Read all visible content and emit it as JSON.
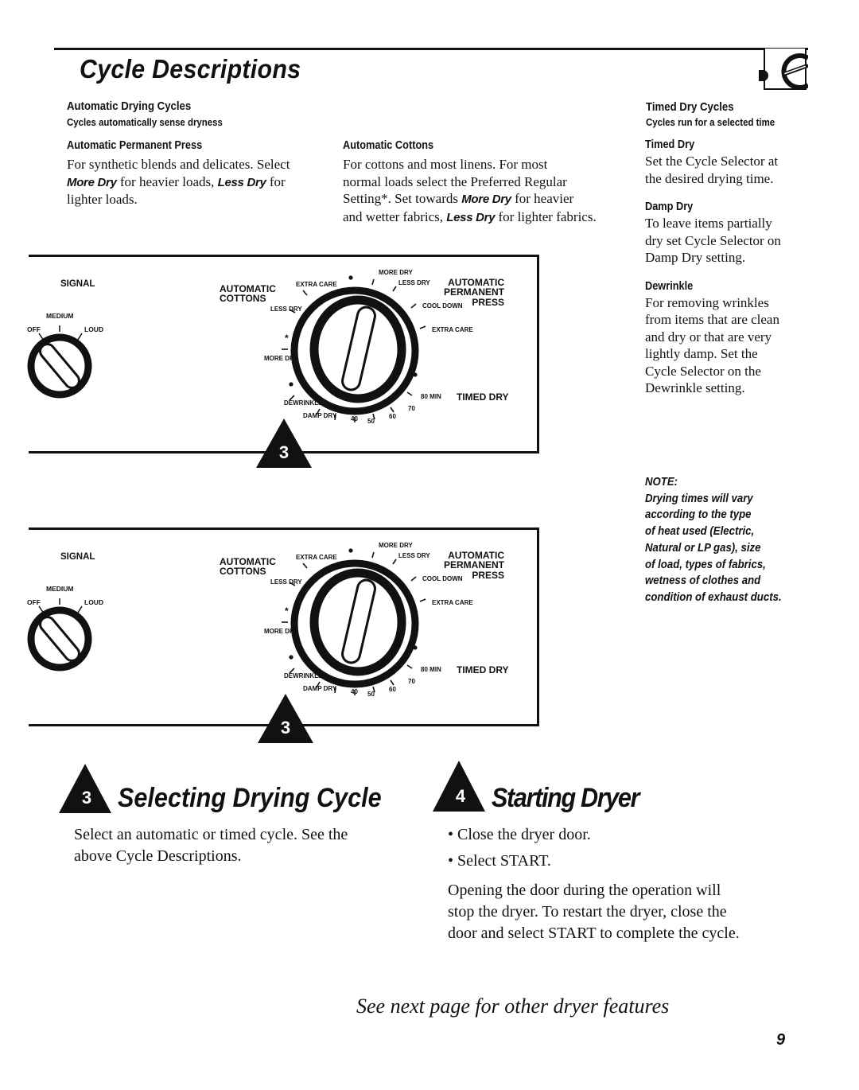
{
  "header": {
    "title": "Cycle Descriptions",
    "corner_icon": "dial-tab-icon"
  },
  "automatic": {
    "heading": "Automatic Drying Cycles",
    "subheading": "Cycles automatically sense dryness",
    "permanent_press": {
      "heading": "Automatic Permanent Press",
      "line1": "For synthetic blends and delicates. Select",
      "more_dry": "More Dry",
      "mid": " for heavier loads, ",
      "less_dry": "Less Dry",
      "end": " for",
      "line3": "lighter loads."
    },
    "cottons": {
      "heading": "Automatic Cottons",
      "line1": "For cottons and most linens. For most",
      "line2": "normal loads select the Preferred Regular",
      "line3a": "Setting*. Set towards ",
      "more_dry": "More Dry",
      "line3b": " for heavier",
      "line4a": "and wetter fabrics, ",
      "less_dry": "Less Dry",
      "line4b": " for lighter fabrics."
    }
  },
  "timed": {
    "heading": "Timed Dry Cycles",
    "subheading": "Cycles run for a selected time",
    "items": [
      {
        "heading": "Timed Dry",
        "lines": [
          "Set the Cycle Selector at",
          "the desired drying time."
        ]
      },
      {
        "heading": "Damp Dry",
        "lines": [
          "To leave items partially",
          "dry set Cycle Selector on",
          "Damp Dry setting."
        ]
      },
      {
        "heading": "Dewrinkle",
        "lines": [
          "For removing wrinkles",
          "from items that are clean",
          "and dry or that are very",
          "lightly damp. Set the",
          "Cycle Selector on the",
          "Dewrinkle setting."
        ]
      }
    ]
  },
  "control_panel": {
    "signal": {
      "label": "SIGNAL",
      "off": "OFF",
      "medium": "MEDIUM",
      "loud": "LOUD"
    },
    "cycle_dial": {
      "auto_cottons": [
        "AUTOMATIC",
        "COTTONS"
      ],
      "auto_perm_press": [
        "AUTOMATIC",
        "PERMANENT",
        "PRESS"
      ],
      "timed_dry": "TIMED DRY",
      "extra_care_left": "EXTRA CARE",
      "less_dry_left": "LESS DRY",
      "preferred_marker": "*",
      "more_dry_left": "MORE DRY",
      "more_dry_top": "MORE DRY",
      "less_dry_right": "LESS DRY",
      "cool_down": "COOL DOWN",
      "extra_care_right": "EXTRA CARE",
      "min_80": "80 MIN",
      "t70": "70",
      "t60": "60",
      "t50": "50",
      "t40": "40",
      "damp_dry": "DAMP DRY",
      "dewrinkle": "DEWRINKLE"
    },
    "step_badge": "3"
  },
  "note": {
    "label": "NOTE:",
    "lines": [
      "Drying times will vary",
      "according to the type",
      "of heat used (Electric,",
      "Natural or LP gas), size",
      "of load, types of fabrics,",
      "wetness of clothes and",
      "condition of exhaust ducts."
    ]
  },
  "step3": {
    "number": "3",
    "title": "Selecting Drying Cycle",
    "lines": [
      "Select an automatic or timed cycle. See the",
      "above Cycle Descriptions."
    ]
  },
  "step4": {
    "number": "4",
    "title": "Starting Dryer",
    "bullets": [
      "Close the dryer door.",
      "Select START."
    ],
    "lines": [
      "Opening the door during the operation will",
      "stop the dryer. To restart the dryer, close the",
      "door and select START to complete the cycle."
    ]
  },
  "footer": {
    "see_next": "See next page for other dryer features",
    "page_number": "9"
  }
}
